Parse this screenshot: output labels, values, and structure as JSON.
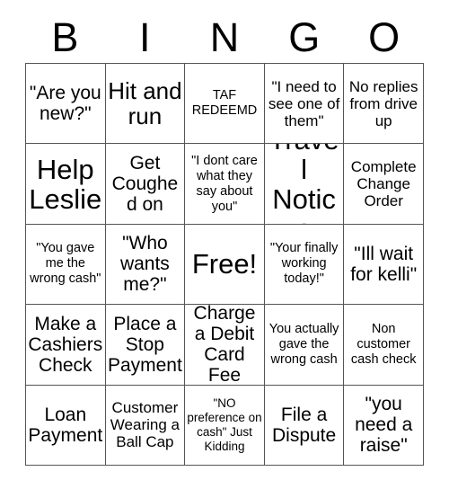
{
  "card": {
    "title": "BINGO",
    "header_letters": [
      "B",
      "I",
      "N",
      "G",
      "O"
    ],
    "free_space_index": 12,
    "colors": {
      "background": "#ffffff",
      "text": "#000000",
      "border": "#555555"
    },
    "rows": [
      [
        {
          "text": "\"Are you new?\"",
          "size": "md"
        },
        {
          "text": "Hit and run",
          "size": "lg"
        },
        {
          "text": "TAF REDEEMD",
          "size": "xs"
        },
        {
          "text": "\"I need to see one of them\"",
          "size": "sm"
        },
        {
          "text": "No replies from drive up",
          "size": "sm"
        }
      ],
      [
        {
          "text": "Help Leslie",
          "size": "xl"
        },
        {
          "text": "Get Coughed on",
          "size": "md"
        },
        {
          "text": "\"I dont care what they say about you\"",
          "size": "xs"
        },
        {
          "text": "Travel Notice",
          "size": "xl"
        },
        {
          "text": "Complete Change Order",
          "size": "sm"
        }
      ],
      [
        {
          "text": "\"You gave me the wrong cash\"",
          "size": "xs"
        },
        {
          "text": "\"Who wants me?\"",
          "size": "md"
        },
        {
          "text": "Free!",
          "size": "xl"
        },
        {
          "text": "\"Your finally working today!\"",
          "size": "xs"
        },
        {
          "text": "\"Ill wait for kelli\"",
          "size": "md"
        }
      ],
      [
        {
          "text": "Make a Cashiers Check",
          "size": "md"
        },
        {
          "text": "Place a Stop Payment",
          "size": "md"
        },
        {
          "text": "Charge a Debit Card Fee",
          "size": "md"
        },
        {
          "text": "You actually gave the wrong cash",
          "size": "xs"
        },
        {
          "text": "Non customer cash check",
          "size": "xs"
        }
      ],
      [
        {
          "text": "Loan Payment",
          "size": "md"
        },
        {
          "text": "Customer Wearing a Ball Cap",
          "size": "sm"
        },
        {
          "text": "\"NO preference on cash\" Just Kidding",
          "size": "xxs"
        },
        {
          "text": "File a Dispute",
          "size": "md"
        },
        {
          "text": "\"you need a raise\"",
          "size": "md"
        }
      ]
    ]
  }
}
